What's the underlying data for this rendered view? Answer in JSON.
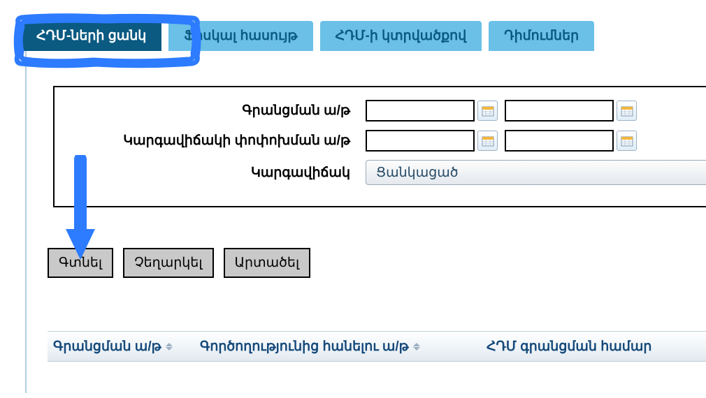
{
  "tabs": [
    {
      "label": "ՀԴՄ-ների ցանկ",
      "active": true
    },
    {
      "label": "Ֆիսկալ հասույթ",
      "active": false
    },
    {
      "label": "ՀԴՄ-ի կտրվածքով",
      "active": false
    },
    {
      "label": "Դիմումներ",
      "active": false
    }
  ],
  "filters": {
    "registration": {
      "label": "Գրանցման ա/թ",
      "from": "",
      "to": ""
    },
    "statusChange": {
      "label": "Կարգավիճակի փոփոխման ա/թ",
      "from": "",
      "to": ""
    },
    "status": {
      "label": "Կարգավիճակ",
      "selected": "Ցանկացած"
    }
  },
  "buttons": {
    "find": "Գտնել",
    "cancel": "Չեղարկել",
    "export": "Արտածել"
  },
  "columns": {
    "registration": "Գրանցման ա/թ",
    "removal": "Գործողությունից հանելու ա/թ",
    "hdmnumber": "ՀԴՄ գրանցման համար"
  },
  "annotation": {
    "highlight_color": "#2d7bff",
    "arrow_color": "#2d7bff"
  }
}
